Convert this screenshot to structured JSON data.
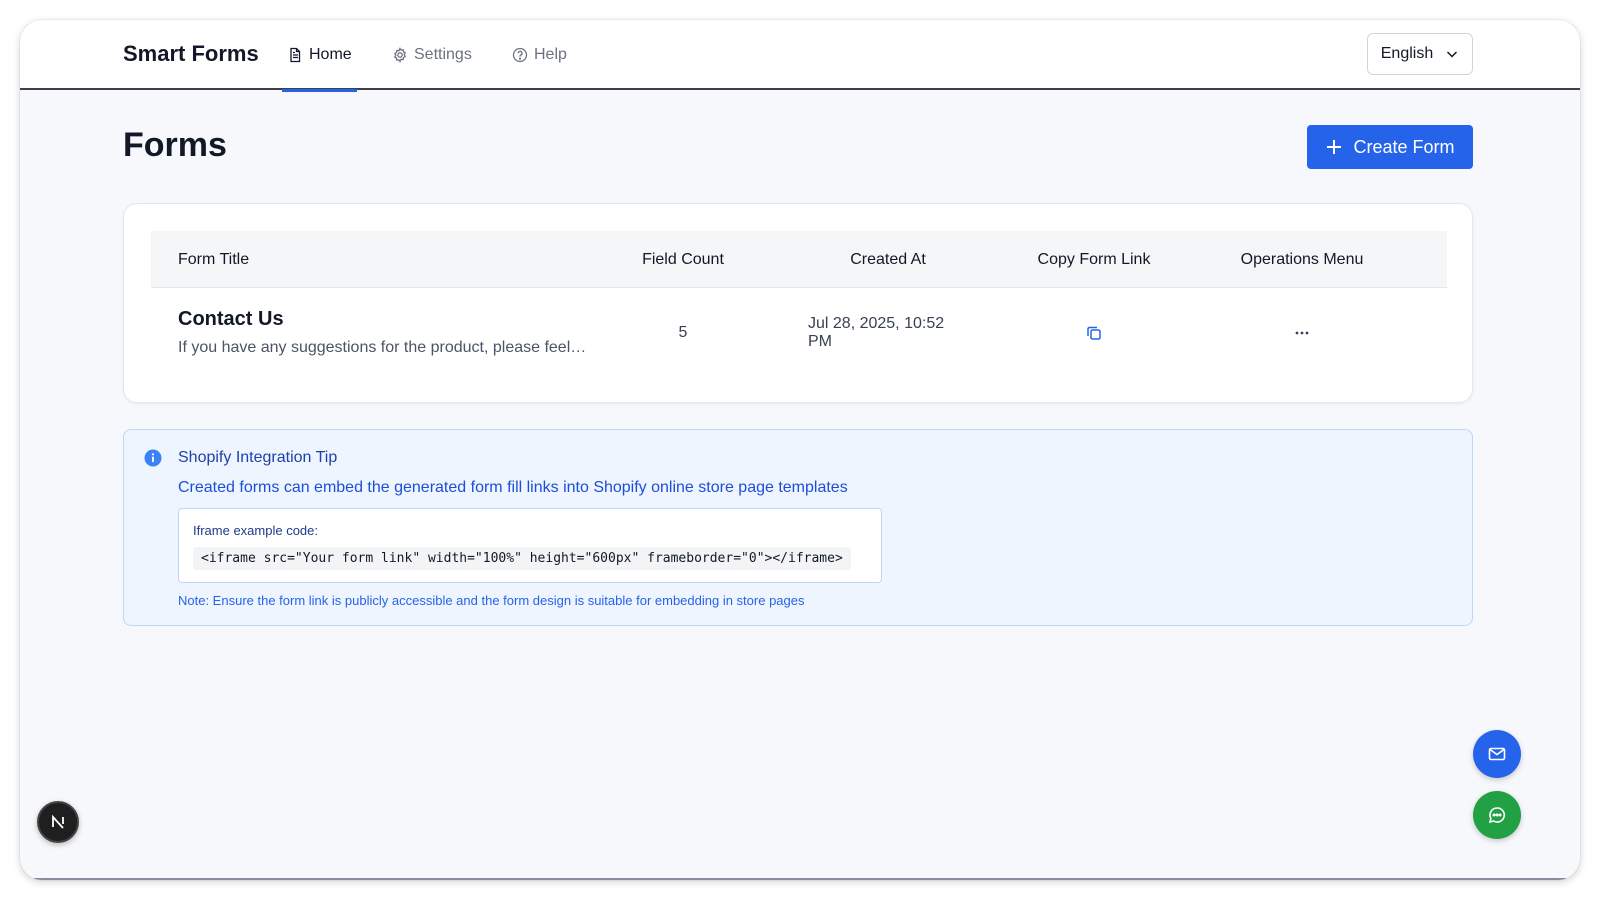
{
  "header": {
    "brand": "Smart Forms",
    "tabs": [
      {
        "label": "Home",
        "icon": "file-icon",
        "active": true
      },
      {
        "label": "Settings",
        "icon": "gear-icon",
        "active": false
      },
      {
        "label": "Help",
        "icon": "help-circle-icon",
        "active": false
      }
    ],
    "language": {
      "selected": "English",
      "icon": "chevron-down-icon"
    }
  },
  "page": {
    "title": "Forms",
    "create_button": "Create Form"
  },
  "table": {
    "columns": [
      "Form Title",
      "Field Count",
      "Created At",
      "Copy Form Link",
      "Operations Menu"
    ],
    "rows": [
      {
        "title": "Contact Us",
        "description": "If you have any suggestions for the product, please feel…",
        "field_count": "5",
        "created_at": "Jul 28, 2025, 10:52 PM",
        "copy_icon": "copy-icon",
        "menu_icon": "more-horizontal-icon"
      }
    ]
  },
  "tip": {
    "icon": "info-icon",
    "title": "Shopify Integration Tip",
    "description": "Created forms can embed the generated form fill links into Shopify online store page templates",
    "code_label": "Iframe example code:",
    "code": "<iframe src=\"Your form link\" width=\"100%\" height=\"600px\" frameborder=\"0\"></iframe>",
    "note": "Note: Ensure the form link is publicly accessible and the form design is suitable for embedding in store pages"
  },
  "floating": {
    "mail_icon": "mail-icon",
    "chat_icon": "chat-icon",
    "framework_badge": "N"
  },
  "colors": {
    "accent": "#2563eb",
    "tip_background": "#eef5ff",
    "chat_green": "#22a044"
  }
}
